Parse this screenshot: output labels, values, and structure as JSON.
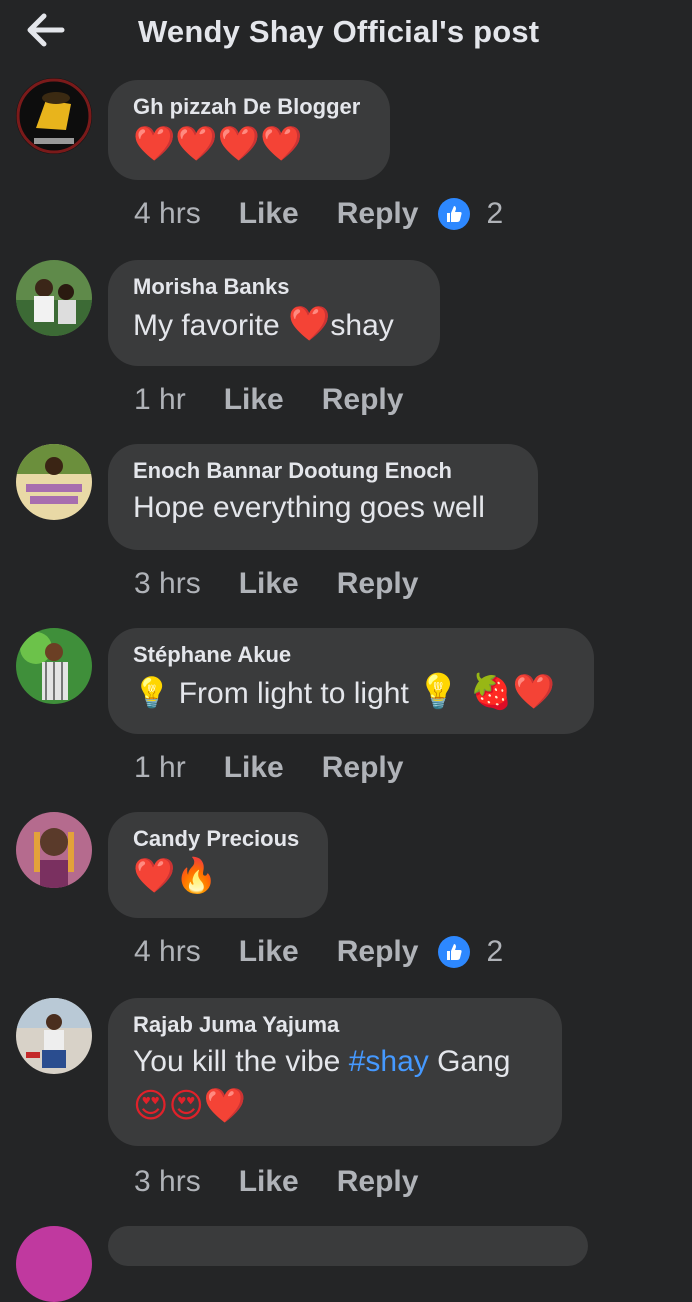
{
  "header": {
    "title": "Wendy Shay Official's post",
    "back_icon": "back-arrow-icon"
  },
  "comments": [
    {
      "author": "Gh pizzah De Blogger",
      "text": "❤️❤️❤️❤️",
      "time": "4 hrs",
      "like": "Like",
      "reply": "Reply",
      "reactions": "2"
    },
    {
      "author": "Morisha Banks",
      "text_before": "My favorite ",
      "emoji": "❤️",
      "text_after": "shay",
      "time": "1 hr",
      "like": "Like",
      "reply": "Reply"
    },
    {
      "author": "Enoch Bannar Dootung Enoch",
      "text": "Hope everything goes well",
      "time": "3 hrs",
      "like": "Like",
      "reply": "Reply"
    },
    {
      "author": "Stéphane Akue",
      "emoji_lead": "💡",
      "text": "From light to light",
      "emoji_trail": "💡 🍓❤️",
      "time": "1 hr",
      "like": "Like",
      "reply": "Reply"
    },
    {
      "author": "Candy Precious",
      "text": "❤️🔥",
      "time": "4 hrs",
      "like": "Like",
      "reply": "Reply",
      "reactions": "2"
    },
    {
      "author": "Rajab Juma Yajuma",
      "text_before": "You kill the vibe ",
      "hashtag": "#shay",
      "text_after": " Gang",
      "line2": "😍😍❤️",
      "time": "3 hrs",
      "like": "Like",
      "reply": "Reply"
    }
  ],
  "colors": {
    "background": "#242526",
    "bubble": "#3a3b3c",
    "link": "#4599ff",
    "like_badge": "#2d88ff"
  }
}
